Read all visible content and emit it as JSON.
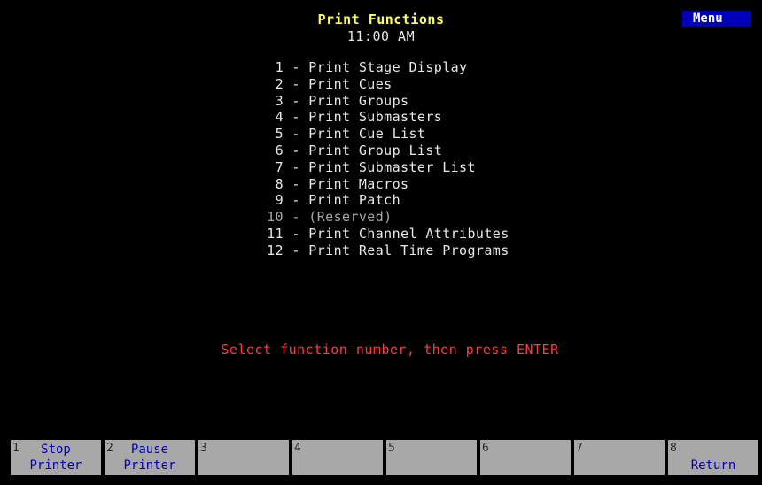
{
  "header": {
    "title": "Print Functions",
    "time": "11:00 AM",
    "menu_label": "Menu"
  },
  "menu": {
    "items": [
      {
        "num": "1",
        "label": "Print Stage Display",
        "enabled": true
      },
      {
        "num": "2",
        "label": "Print Cues",
        "enabled": true
      },
      {
        "num": "3",
        "label": "Print Groups",
        "enabled": true
      },
      {
        "num": "4",
        "label": "Print Submasters",
        "enabled": true
      },
      {
        "num": "5",
        "label": "Print Cue List",
        "enabled": true
      },
      {
        "num": "6",
        "label": "Print Group List",
        "enabled": true
      },
      {
        "num": "7",
        "label": "Print Submaster List",
        "enabled": true
      },
      {
        "num": "8",
        "label": "Print Macros",
        "enabled": true
      },
      {
        "num": "9",
        "label": "Print Patch",
        "enabled": true
      },
      {
        "num": "10",
        "label": "(Reserved)",
        "enabled": false
      },
      {
        "num": "11",
        "label": "Print Channel Attributes",
        "enabled": true
      },
      {
        "num": "12",
        "label": "Print Real Time Programs",
        "enabled": true
      }
    ],
    "separator": " - "
  },
  "prompt": "Select function number, then press ENTER",
  "softkeys": [
    {
      "num": "1",
      "line1": "Stop",
      "line2": "Printer"
    },
    {
      "num": "2",
      "line1": "Pause",
      "line2": "Printer"
    },
    {
      "num": "3",
      "line1": "",
      "line2": ""
    },
    {
      "num": "4",
      "line1": "",
      "line2": ""
    },
    {
      "num": "5",
      "line1": "",
      "line2": ""
    },
    {
      "num": "6",
      "line1": "",
      "line2": ""
    },
    {
      "num": "7",
      "line1": "",
      "line2": ""
    },
    {
      "num": "8",
      "line1": "",
      "line2": "Return"
    }
  ],
  "colors": {
    "background": "#000000",
    "title": "#ffff55",
    "text": "#e8e8e8",
    "disabled_text": "#a8a8a8",
    "prompt": "#ff3b3b",
    "menu_tag_bg": "#0000b8",
    "softkey_bg": "#a8a8a8",
    "softkey_text": "#0000b8"
  }
}
